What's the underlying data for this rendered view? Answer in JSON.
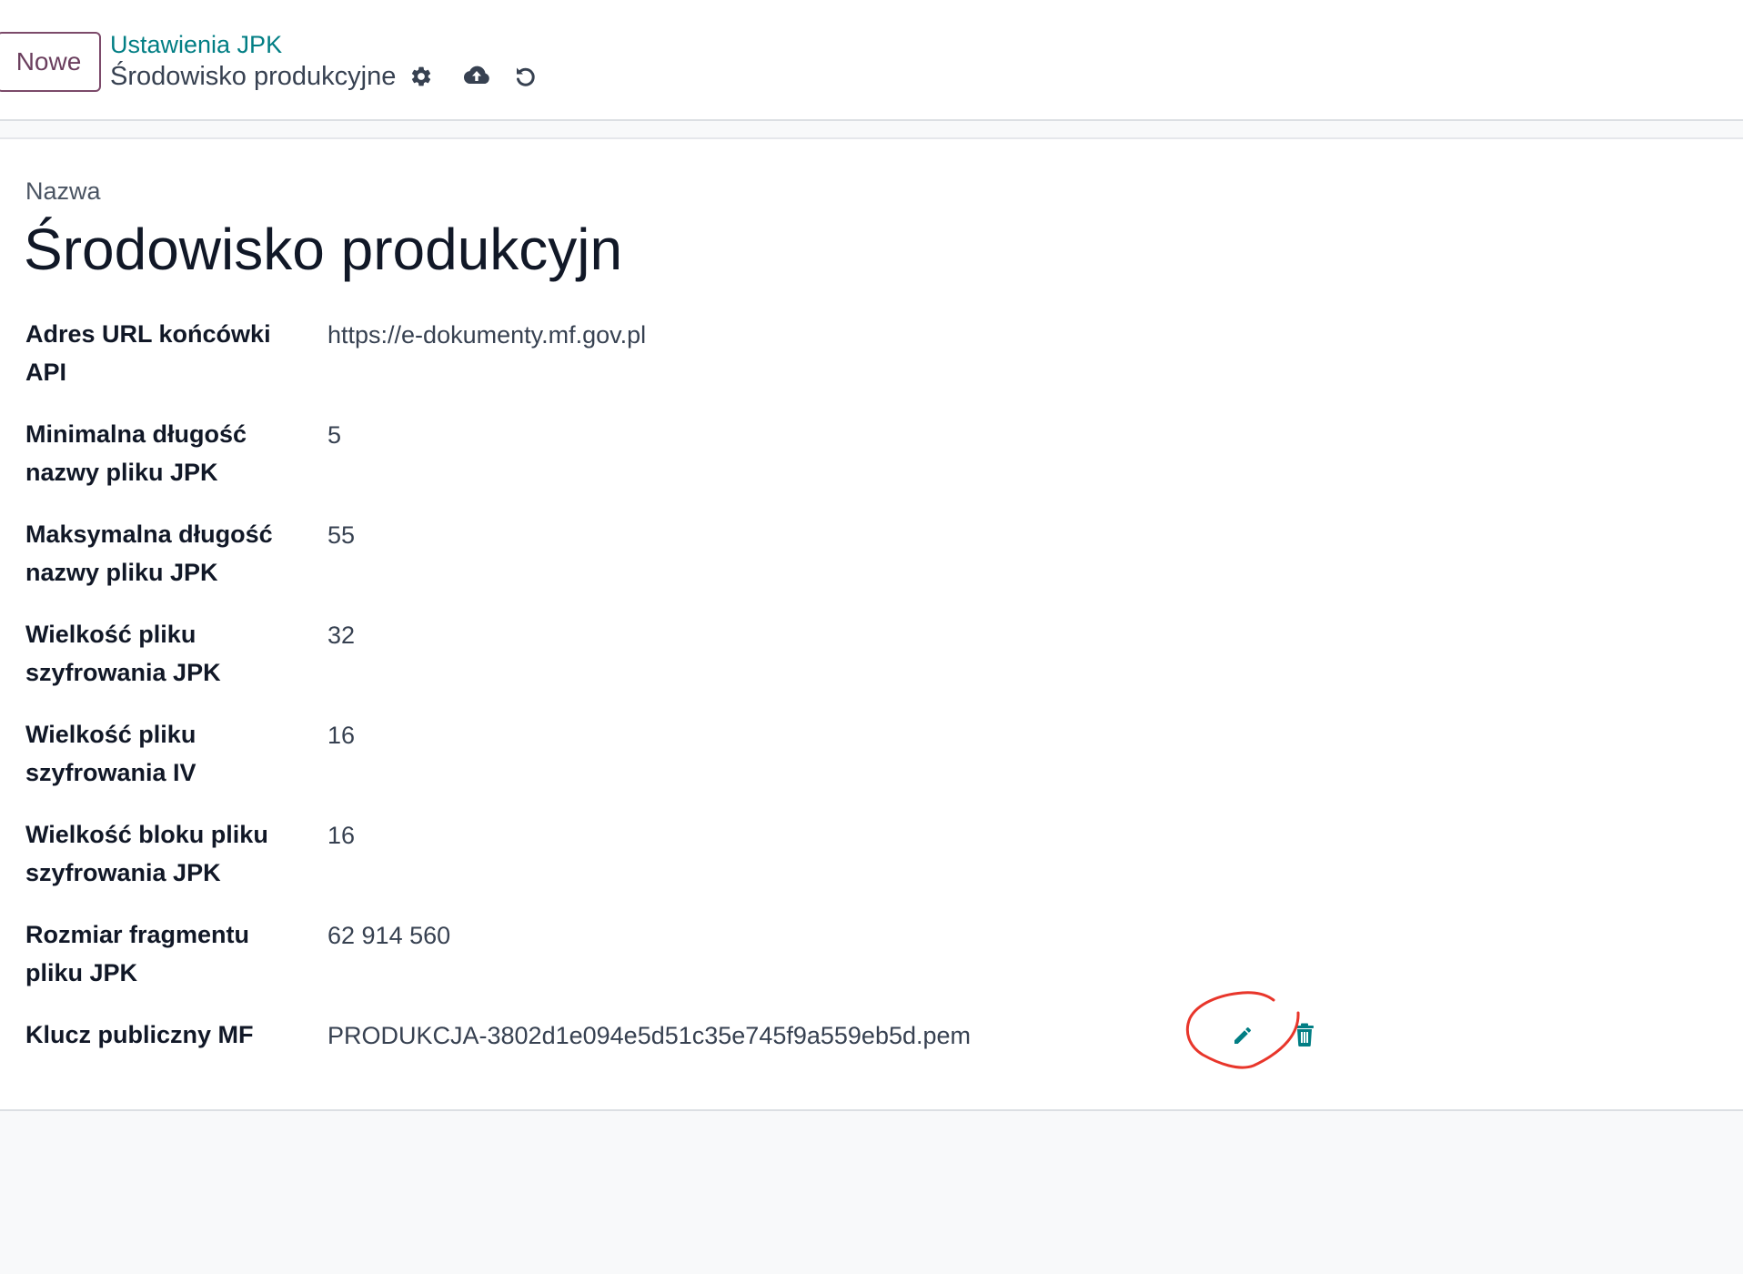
{
  "header": {
    "new_button_label": "Nowe",
    "breadcrumb_parent": "Ustawienia JPK",
    "breadcrumb_current": "Środowisko produkcyjne",
    "icons": [
      "gear-icon",
      "cloud-upload-icon",
      "undo-icon"
    ]
  },
  "form": {
    "name_label": "Nazwa",
    "name_value": "Środowisko produkcyjn",
    "fields": [
      {
        "label": "Adres URL końcówki API",
        "value": "https://e-dokumenty.mf.gov.pl"
      },
      {
        "label": "Minimalna długość nazwy pliku JPK",
        "value": "5"
      },
      {
        "label": "Maksymalna długość nazwy pliku JPK",
        "value": "55"
      },
      {
        "label": "Wielkość pliku szyfrowania JPK",
        "value": "32"
      },
      {
        "label": "Wielkość pliku szyfrowania IV",
        "value": "16"
      },
      {
        "label": "Wielkość bloku pliku szyfrowania JPK",
        "value": "16"
      },
      {
        "label": "Rozmiar fragmentu pliku JPK",
        "value": "62 914 560"
      },
      {
        "label": "Klucz publiczny MF",
        "value": "PRODUKCJA-3802d1e094e5d51c35e745f9a559eb5d.pem"
      }
    ],
    "file_actions": [
      "pencil-icon",
      "trash-icon"
    ]
  },
  "colors": {
    "accent": "#017e84",
    "primary_button": "#6b3f5e",
    "annotation": "#e8362b"
  }
}
